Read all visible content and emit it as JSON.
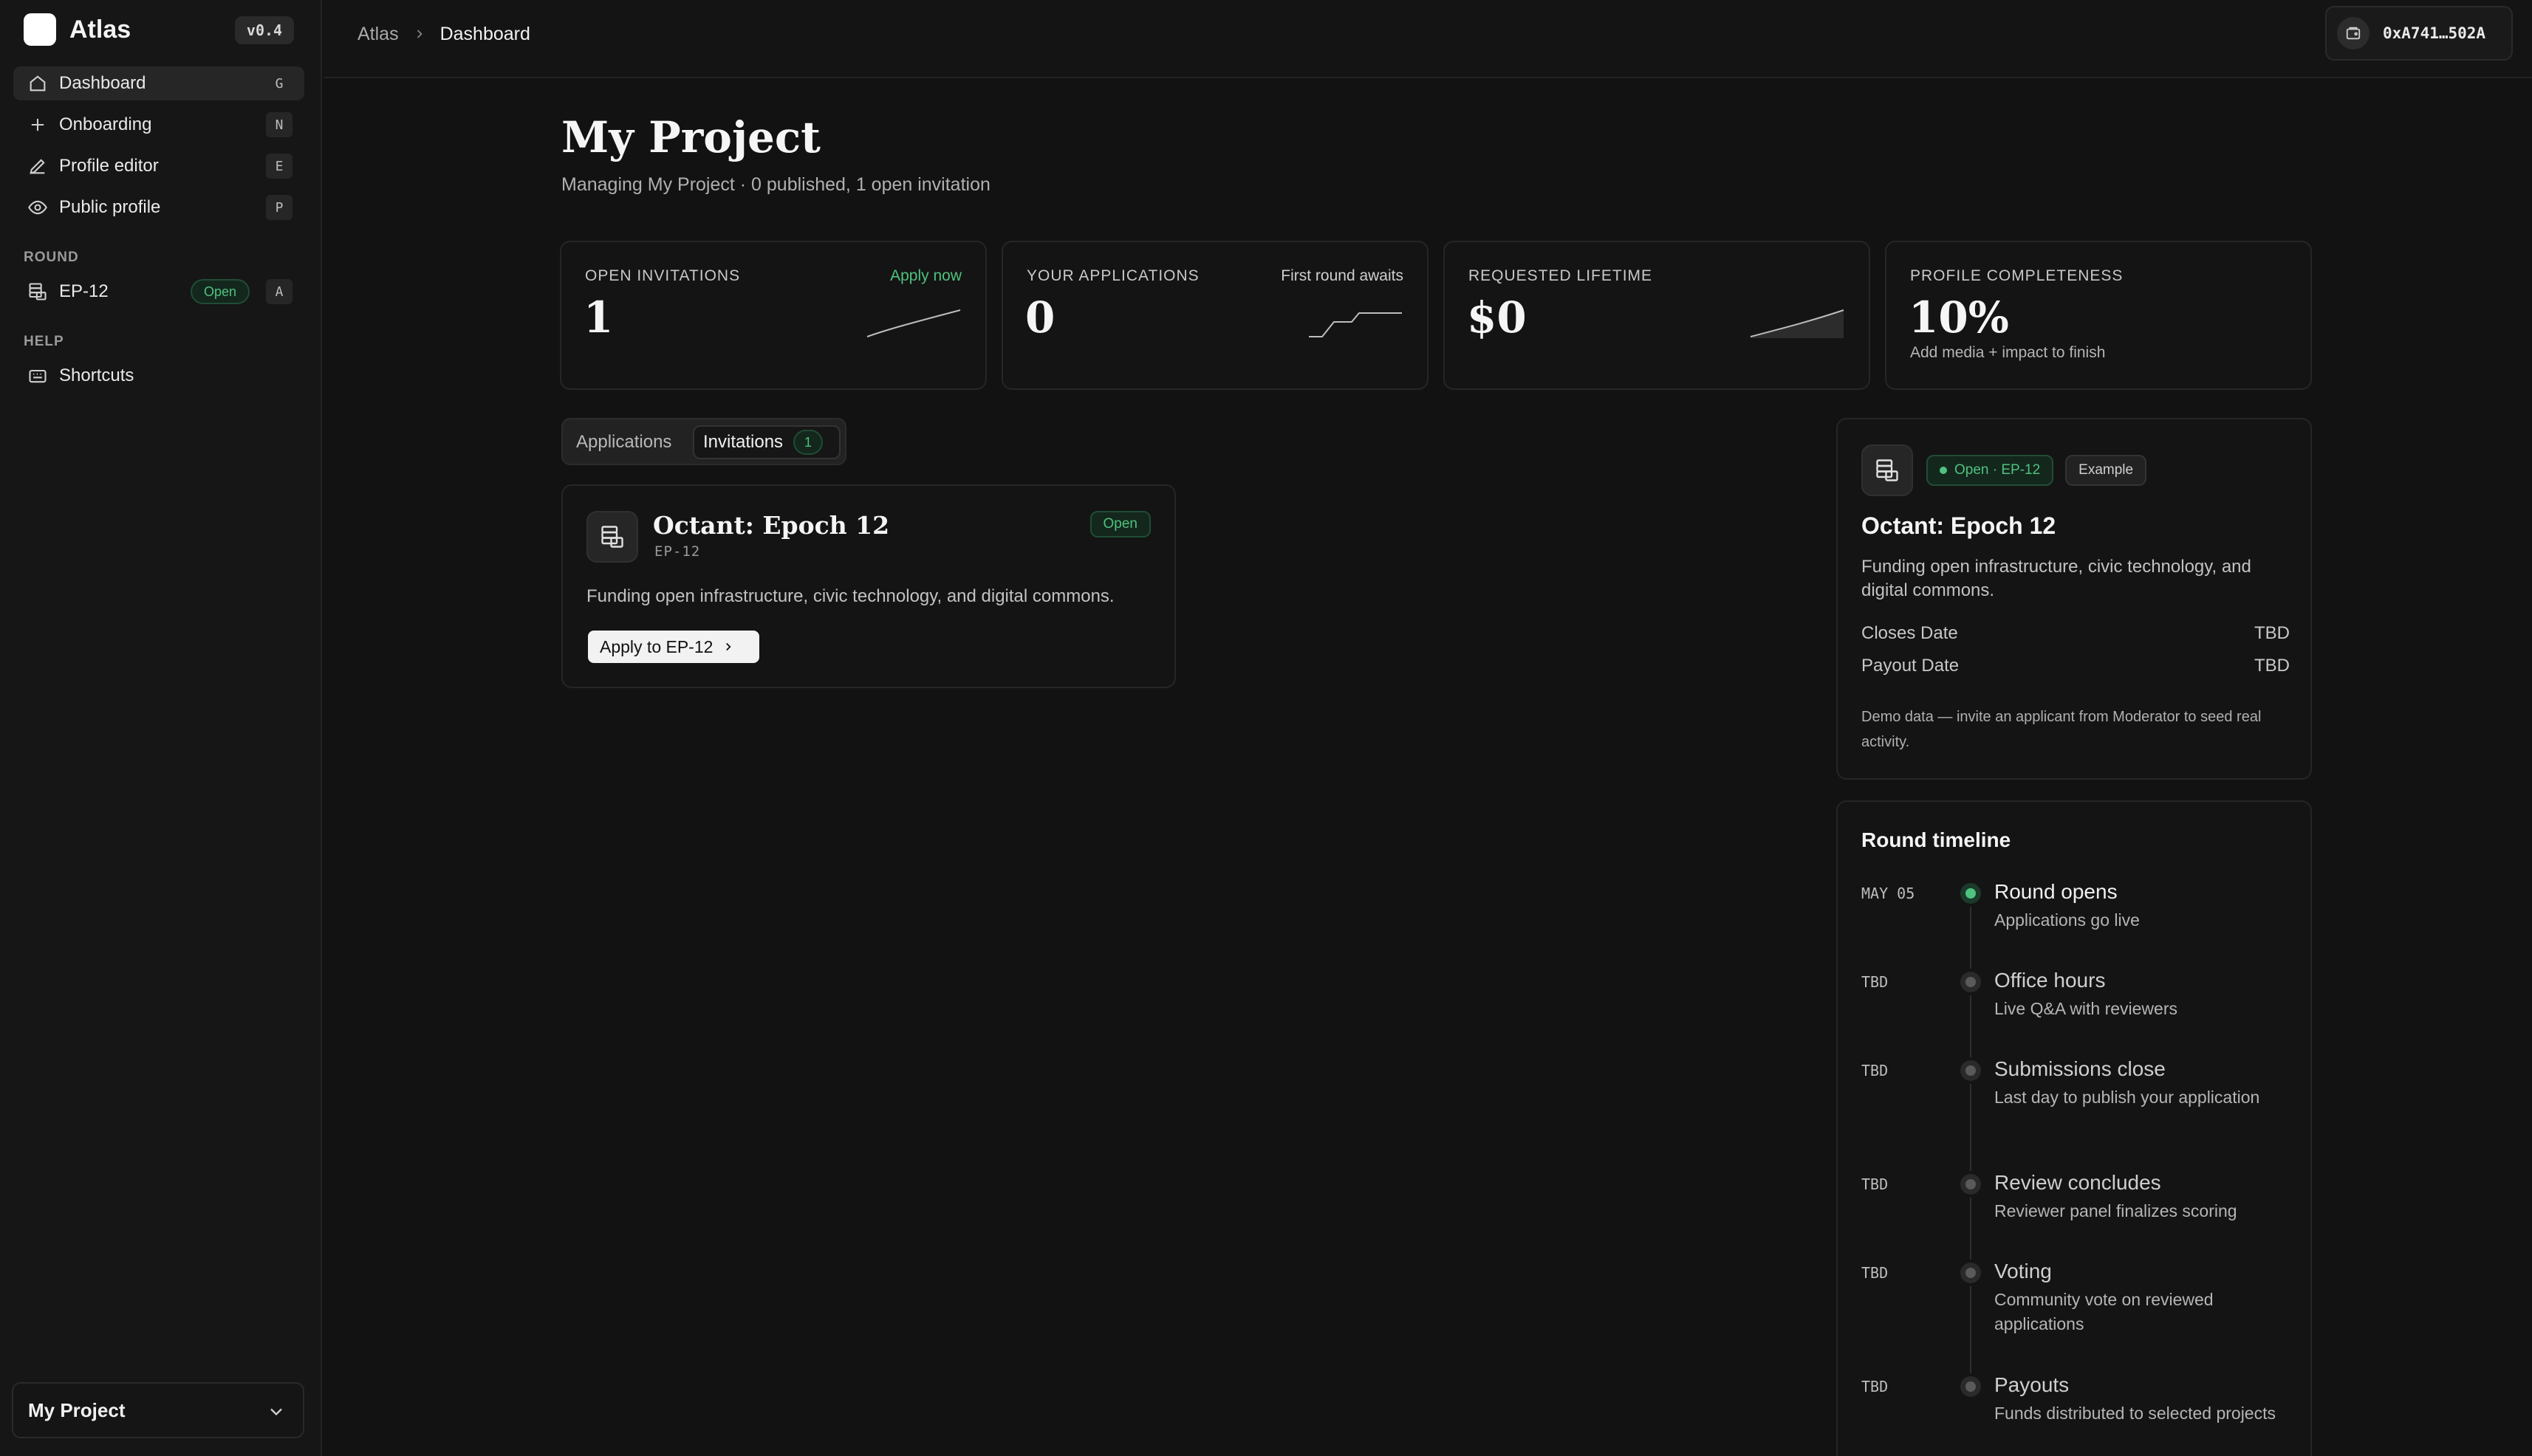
{
  "app": {
    "name": "Atlas",
    "version": "v0.4"
  },
  "sidebar": {
    "nav": [
      {
        "label": "Dashboard",
        "key": "G",
        "icon": "home-icon",
        "active": true
      },
      {
        "label": "Onboarding",
        "key": "N",
        "icon": "plus-icon"
      },
      {
        "label": "Profile editor",
        "key": "E",
        "icon": "pencil-icon"
      },
      {
        "label": "Public profile",
        "key": "P",
        "icon": "eye-icon"
      }
    ],
    "round_section": "ROUND",
    "round_item": {
      "label": "EP-12",
      "status": "Open",
      "key": "A"
    },
    "help_section": "HELP",
    "help_item": {
      "label": "Shortcuts"
    },
    "project_switcher": "My Project"
  },
  "topbar": {
    "breadcrumb_root": "Atlas",
    "breadcrumb_current": "Dashboard",
    "wallet": "0xA741…502A"
  },
  "page": {
    "title": "My Project",
    "subtitle": "Managing My Project · 0 published, 1 open invitation"
  },
  "stats": [
    {
      "label": "OPEN INVITATIONS",
      "value": "1",
      "aside": "Apply now"
    },
    {
      "label": "YOUR APPLICATIONS",
      "value": "0",
      "aside": "First round awaits"
    },
    {
      "label": "REQUESTED LIFETIME",
      "value": "$0"
    },
    {
      "label": "PROFILE COMPLETENESS",
      "value": "10%",
      "note": "Add media + impact to finish"
    }
  ],
  "tabs": {
    "applications": "Applications",
    "invitations": "Invitations",
    "invitations_count": "1"
  },
  "invitation": {
    "title": "Octant: Epoch 12",
    "code": "EP-12",
    "status": "Open",
    "description": "Funding open infrastructure, civic technology, and digital commons.",
    "cta": "Apply to EP-12"
  },
  "round": {
    "badge_open": "Open · EP-12",
    "badge_example": "Example",
    "title": "Octant: Epoch 12",
    "description": "Funding open infrastructure, civic technology, and digital commons.",
    "closes_label": "Closes Date",
    "closes_value": "TBD",
    "payout_label": "Payout Date",
    "payout_value": "TBD",
    "note": "Demo data — invite an applicant from Moderator to seed real activity."
  },
  "timeline": {
    "heading": "Round timeline",
    "items": [
      {
        "date": "MAY 05",
        "title": "Round opens",
        "desc": "Applications go live",
        "active": true
      },
      {
        "date": "TBD",
        "title": "Office hours",
        "desc": "Live Q&A with reviewers"
      },
      {
        "date": "TBD",
        "title": "Submissions close",
        "desc": "Last day to publish your application"
      },
      {
        "date": "TBD",
        "title": "Review concludes",
        "desc": "Reviewer panel finalizes scoring"
      },
      {
        "date": "TBD",
        "title": "Voting",
        "desc": "Community vote on reviewed applications"
      },
      {
        "date": "TBD",
        "title": "Payouts",
        "desc": "Funds distributed to selected projects"
      }
    ]
  },
  "colors": {
    "accent_green": "#4fc27e",
    "background": "#121212"
  }
}
